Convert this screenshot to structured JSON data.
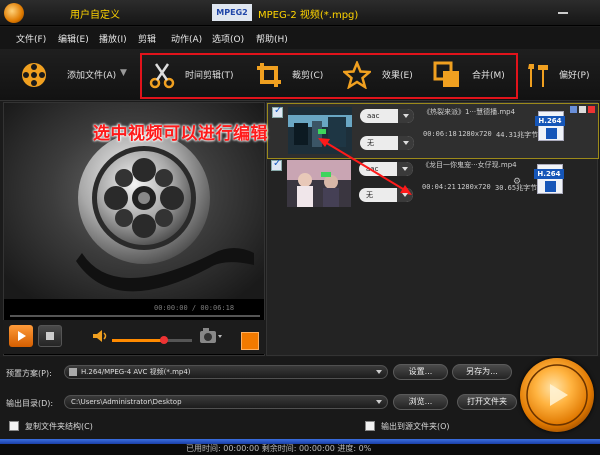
{
  "window": {
    "title_left": "用户自定义",
    "format_badge": "MPEG2",
    "title_right": "MPEG-2 视频(*.mpg)"
  },
  "menu": [
    "文件(F)",
    "编辑(E)",
    "播放(I)",
    "剪辑",
    "动作(A)",
    "选项(O)",
    "帮助(H)"
  ],
  "toolbar": {
    "add_file": "添加文件(A)",
    "trim": "时间剪辑(T)",
    "crop": "裁剪(C)",
    "effect": "效果(E)",
    "merge": "合并(M)",
    "prefs": "偏好(P)"
  },
  "annotation": "选中视频可以进行编辑",
  "preview": {
    "timecode": "00:00:00 / 00:06:18"
  },
  "files": [
    {
      "name": "《热裂来派》1···慧德播.mp4",
      "audio": "aac",
      "subtitle": "无",
      "duration": "00:06:18",
      "resolution": "1280x720",
      "fps": "44.31兆字节",
      "codec": "H.264",
      "selected": true
    },
    {
      "name": "《龙目一你鬼宠···女仔现.mp4",
      "audio": "aac",
      "subtitle": "无",
      "duration": "00:04:21",
      "resolution": "1280x720",
      "fps": "30.65兆字节",
      "codec": "H.264",
      "selected": false
    }
  ],
  "bottom": {
    "preset_label": "预置方案(P):",
    "preset_value": "H.264/MPEG-4 AVC 视频(*.mp4)",
    "settings_btn": "设置...",
    "saveas_btn": "另存为...",
    "output_label": "输出目录(D):",
    "output_value": "C:\\Users\\Administrator\\Desktop",
    "browse_btn": "浏览...",
    "openfolder_btn": "打开文件夹",
    "copy_structure": "复制文件夹结构(C)",
    "output_to_source": "输出到源文件夹(O)"
  },
  "status": {
    "text": "已用时间: 00:00:00    剩余时间: 00:00:00    进度: 0%"
  },
  "colors": {
    "accent": "#ff8a00",
    "highlight_box": "#e1131b",
    "annotation": "#ff1a1a",
    "title_text": "#ffd400"
  }
}
